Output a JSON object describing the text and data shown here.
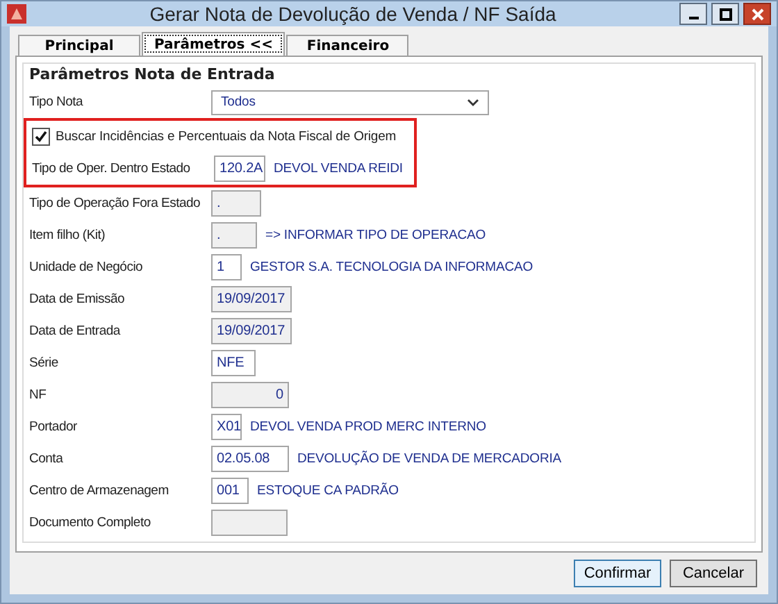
{
  "window": {
    "title": "Gerar Nota de Devolução de Venda / NF Saída"
  },
  "tabs": [
    {
      "label": "Principal",
      "selected": false
    },
    {
      "label": "Parâmetros <<",
      "selected": true
    },
    {
      "label": "Financeiro",
      "selected": false
    }
  ],
  "group": {
    "title": "Parâmetros Nota de Entrada",
    "rows": [
      {
        "kind": "select",
        "label": "Tipo Nota",
        "value": "Todos",
        "highlighted": false
      },
      {
        "kind": "checkbox",
        "label": "Buscar Incidências e Percentuais da Nota Fiscal de Origem",
        "checked": true,
        "highlighted": true
      },
      {
        "kind": "field",
        "label": "Tipo de Oper. Dentro Estado",
        "value": "120.2A",
        "disabled": false,
        "description": "DEVOL VENDA REIDI",
        "highlighted": true
      },
      {
        "kind": "field",
        "label": "Tipo de Operação Fora Estado",
        "value": ".",
        "disabled": true,
        "highlighted": false
      },
      {
        "kind": "field",
        "label": "Item filho (Kit)",
        "value": ".",
        "disabled": true,
        "description": "=> INFORMAR TIPO DE OPERACAO",
        "highlighted": false
      },
      {
        "kind": "field",
        "label": "Unidade de Negócio",
        "value": "1",
        "disabled": false,
        "description": "GESTOR S.A. TECNOLOGIA DA INFORMACAO",
        "highlighted": false
      },
      {
        "kind": "field",
        "label": "Data de Emissão",
        "value": "19/09/2017",
        "disabled": true,
        "highlighted": false
      },
      {
        "kind": "field",
        "label": "Data de Entrada",
        "value": "19/09/2017",
        "disabled": true,
        "highlighted": false
      },
      {
        "kind": "field",
        "label": "Série",
        "value": "NFE",
        "disabled": false,
        "highlighted": false
      },
      {
        "kind": "number",
        "label": "NF",
        "value": "0",
        "disabled": true,
        "highlighted": false
      },
      {
        "kind": "field",
        "label": "Portador",
        "value": "X01",
        "disabled": false,
        "description": "DEVOL VENDA PROD MERC INTERNO",
        "highlighted": false
      },
      {
        "kind": "field",
        "label": "Conta",
        "value": "02.05.08",
        "disabled": false,
        "description": "DEVOLUÇÃO DE VENDA DE MERCADORIA",
        "highlighted": false
      },
      {
        "kind": "field",
        "label": "Centro de Armazenagem",
        "value": "001",
        "disabled": false,
        "description": "ESTOQUE CA PADRÃO",
        "highlighted": false
      },
      {
        "kind": "field",
        "label": "Documento Completo",
        "value": "",
        "disabled": true,
        "highlighted": false
      }
    ]
  },
  "buttons": [
    "Confirmar",
    "Cancelar"
  ]
}
